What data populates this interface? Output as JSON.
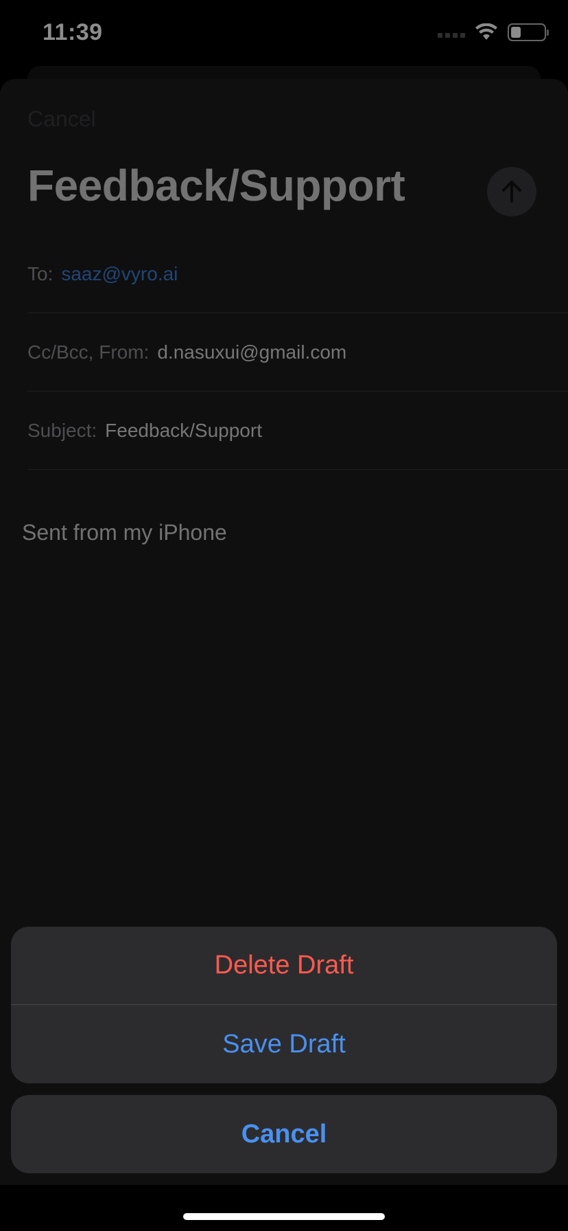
{
  "status_bar": {
    "time": "11:39",
    "battery_level": 0.3
  },
  "compose": {
    "cancel_label": "Cancel",
    "title": "Feedback/Support",
    "to_label": "To:",
    "to_value": "saaz@vyro.ai",
    "cc_label": "Cc/Bcc, From:",
    "cc_value": "d.nasuxui@gmail.com",
    "subject_label": "Subject:",
    "subject_value": "Feedback/Support",
    "body": "Sent from my iPhone"
  },
  "action_sheet": {
    "delete_label": "Delete Draft",
    "save_label": "Save Draft",
    "cancel_label": "Cancel"
  },
  "colors": {
    "destructive": "#ff5a4f",
    "accent": "#4a90f0",
    "link": "#3d7fd6"
  }
}
